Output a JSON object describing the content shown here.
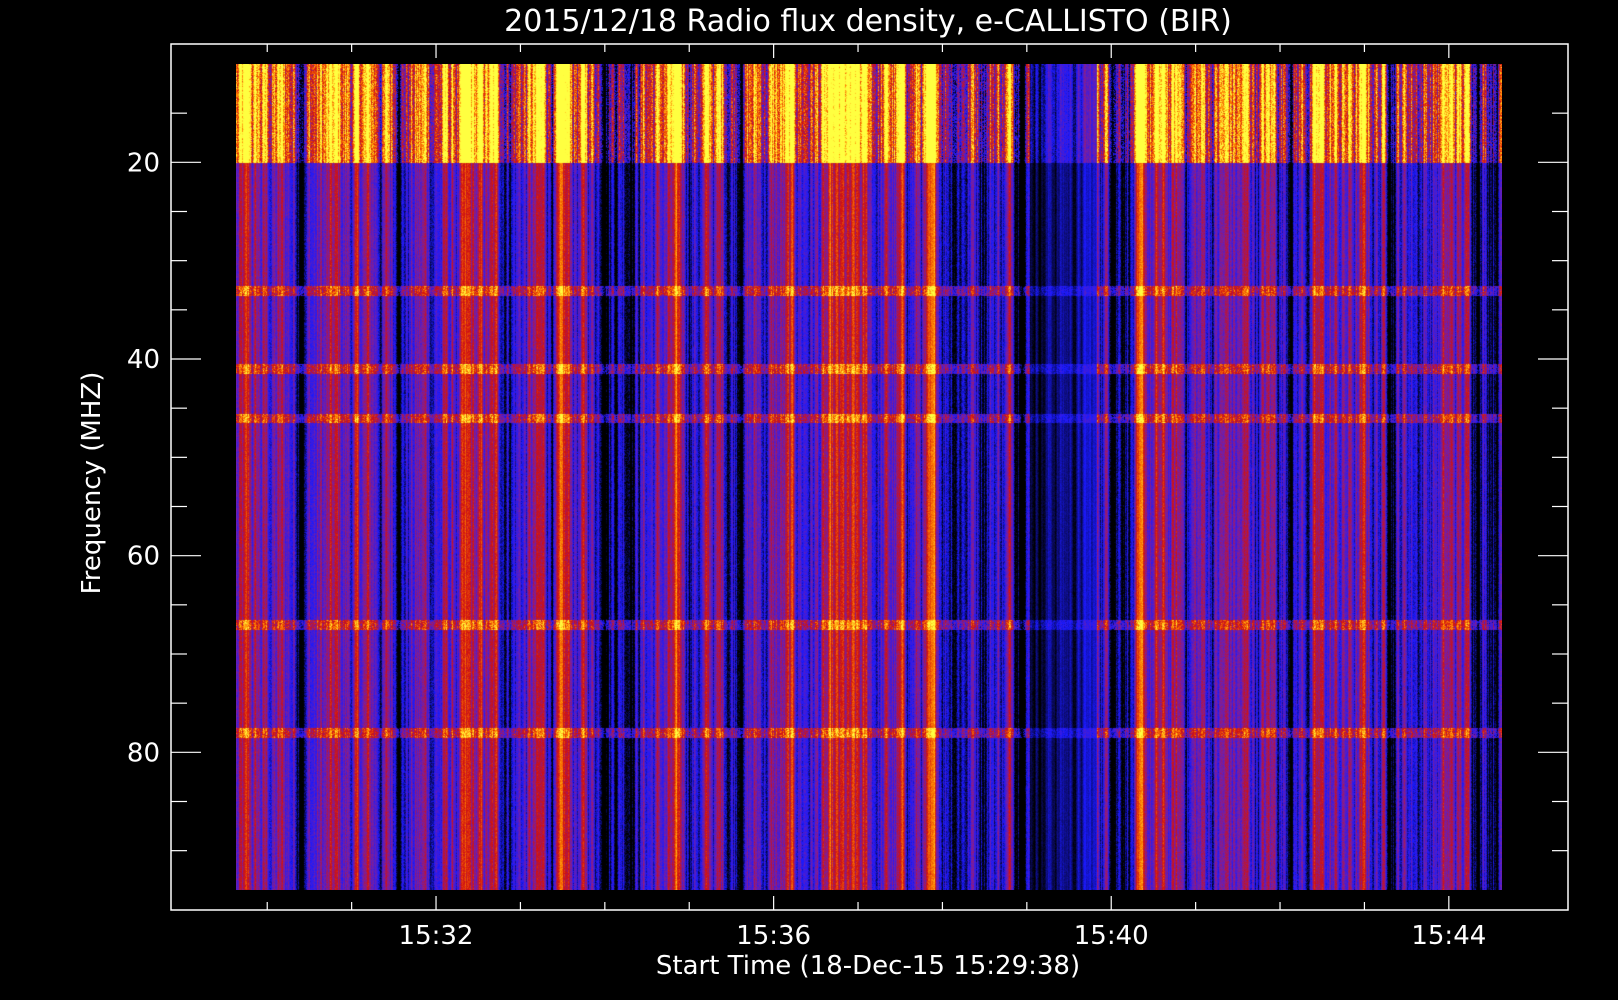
{
  "chart_data": {
    "type": "heatmap",
    "title": "2015/12/18  Radio flux density, e-CALLISTO (BIR)",
    "xlabel": "Start Time (18-Dec-15 15:29:38)",
    "ylabel": "Frequency (MHZ)",
    "x_ticks": [
      "15:32",
      "15:36",
      "15:40",
      "15:44"
    ],
    "x_tick_minutes": [
      2.37,
      6.37,
      10.37,
      14.37
    ],
    "xlim_minutes": [
      0,
      15
    ],
    "y_ticks": [
      20,
      40,
      60,
      80
    ],
    "ylim": [
      10,
      94
    ],
    "y_inverted": true,
    "colormap": [
      "#000000",
      "#1a1aff",
      "#7a1fa0",
      "#d01010",
      "#ff8000",
      "#ffff40"
    ],
    "features": {
      "bright_band_mhz": [
        10,
        20
      ],
      "horizontal_lines_mhz": [
        33,
        41,
        46,
        67,
        78
      ],
      "dark_gap_minutes": [
        9.4,
        10.2
      ]
    }
  }
}
